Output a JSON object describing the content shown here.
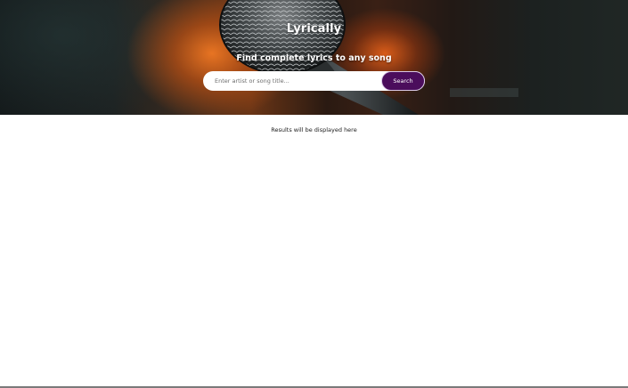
{
  "header": {
    "brand": "Lyrically",
    "tagline": "Find complete lyrics to any song"
  },
  "search": {
    "placeholder": "Enter artist or song title...",
    "value": "",
    "button_label": "Search"
  },
  "results": {
    "placeholder_text": "Results will be displayed here"
  },
  "colors": {
    "button_bg": "#4b0d5c",
    "hero_overlay": "#141a1b",
    "text_on_hero": "#ffffff"
  }
}
